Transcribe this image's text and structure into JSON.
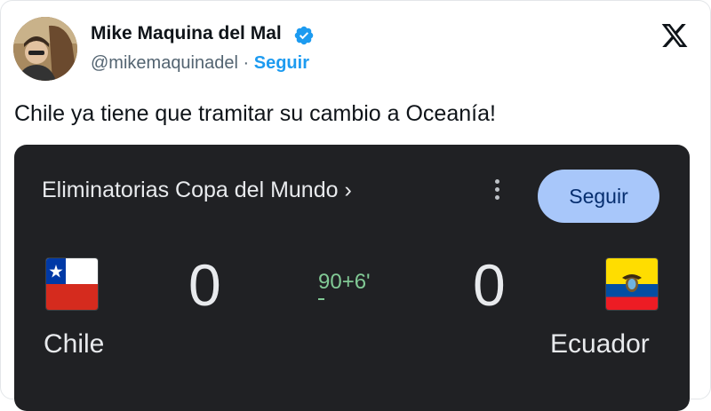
{
  "tweet": {
    "author_name": "Mike Maquina del Mal",
    "handle": "@mikemaquinadel",
    "separator": "·",
    "follow_label": "Seguir",
    "text": "Chile ya tiene que tramitar su cambio a Oceanía!",
    "verified": true,
    "colors": {
      "link": "#1d9bf0",
      "verified": "#1d9bf0"
    }
  },
  "match_card": {
    "competition": "Eliminatorias Copa del Mundo",
    "competition_chevron": "›",
    "follow_label": "Seguir",
    "home": {
      "team": "Chile",
      "score": "0",
      "flag": "chile-flag"
    },
    "away": {
      "team": "Ecuador",
      "score": "0",
      "flag": "ecuador-flag"
    },
    "minute": "90+6'",
    "status_color": "#81c995",
    "colors": {
      "background": "#202124",
      "button": "#a8c7fa"
    }
  },
  "icons": [
    "avatar",
    "verified-badge-icon",
    "x-logo-icon",
    "more-vert-icon"
  ]
}
